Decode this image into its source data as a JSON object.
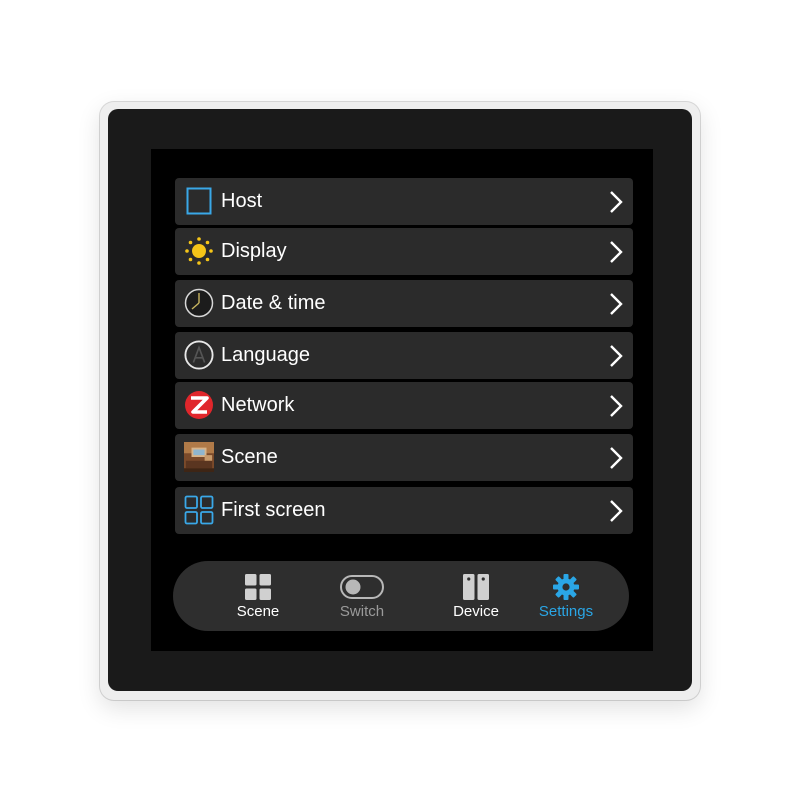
{
  "menu": {
    "items": [
      {
        "label": "Host",
        "icon": "square-outline-icon"
      },
      {
        "label": "Display",
        "icon": "sun-icon"
      },
      {
        "label": "Date & time",
        "icon": "clock-icon"
      },
      {
        "label": "Language",
        "icon": "language-a-icon"
      },
      {
        "label": "Network",
        "icon": "zigbee-icon"
      },
      {
        "label": "Scene",
        "icon": "scene-photo-icon"
      },
      {
        "label": "First screen",
        "icon": "grid-icon"
      }
    ]
  },
  "tabbar": {
    "tabs": [
      {
        "label": "Scene",
        "icon": "grid-icon",
        "state": "normal"
      },
      {
        "label": "Switch",
        "icon": "toggle-icon",
        "state": "dim"
      },
      {
        "label": "Device",
        "icon": "device-panel-icon",
        "state": "normal"
      },
      {
        "label": "Settings",
        "icon": "gear-icon",
        "state": "active"
      }
    ]
  },
  "colors": {
    "accent": "#2aa6e6",
    "item_bg": "#2b2b2b",
    "screen_bg": "#000000",
    "sun": "#f5c518",
    "zigbee_red": "#e0262b"
  }
}
